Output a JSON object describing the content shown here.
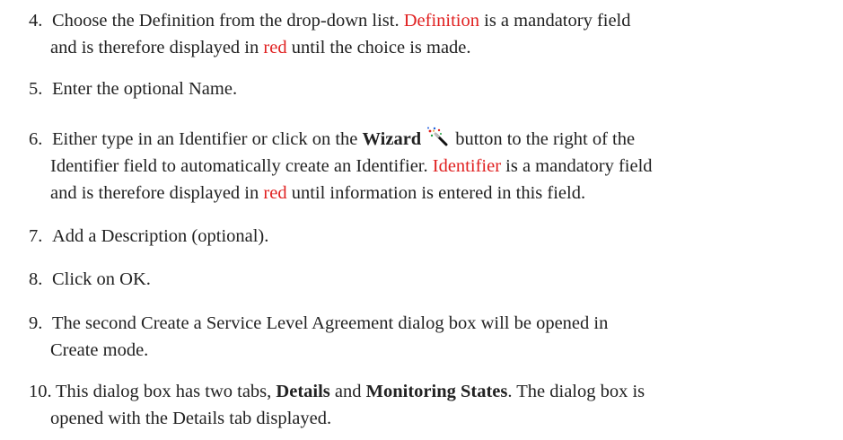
{
  "steps": [
    {
      "num": "4.",
      "line1_a": "Choose the Definition from the drop-down list. ",
      "line1_red": "Definition",
      "line1_b": " is a mandatory field",
      "line2_a": "and is therefore displayed in ",
      "line2_red": "red",
      "line2_b": " until the choice is made."
    },
    {
      "num": "5.",
      "line1": "Enter the optional Name."
    },
    {
      "num": "6.",
      "line1_a": "Either type in an Identifier or click on the ",
      "line1_bold": "Wizard",
      "line1_icon": "wizard-wand-icon",
      "line1_b": "button to the right of the",
      "line2_a": "Identifier field to automatically create an Identifier. ",
      "line2_red": "Identifier",
      "line2_b": " is a mandatory field",
      "line3_a": "and is therefore displayed in ",
      "line3_red": "red",
      "line3_b": " until information is entered in this field."
    },
    {
      "num": "7.",
      "line1": "Add a Description (optional)."
    },
    {
      "num": "8.",
      "line1": "Click on OK."
    },
    {
      "num": "9.",
      "line1": "The second Create a Service Level Agreement dialog box will be opened in",
      "line2": "Create mode."
    },
    {
      "num": "10.",
      "line1_a": "This dialog box has two tabs, ",
      "line1_bold1": "Details",
      "line1_mid": " and ",
      "line1_bold2": "Monitoring States",
      "line1_b": ". The dialog box is",
      "line2": "opened with the Details tab displayed."
    }
  ],
  "colors": {
    "text": "#222222",
    "mandatory_red": "#e02020"
  }
}
